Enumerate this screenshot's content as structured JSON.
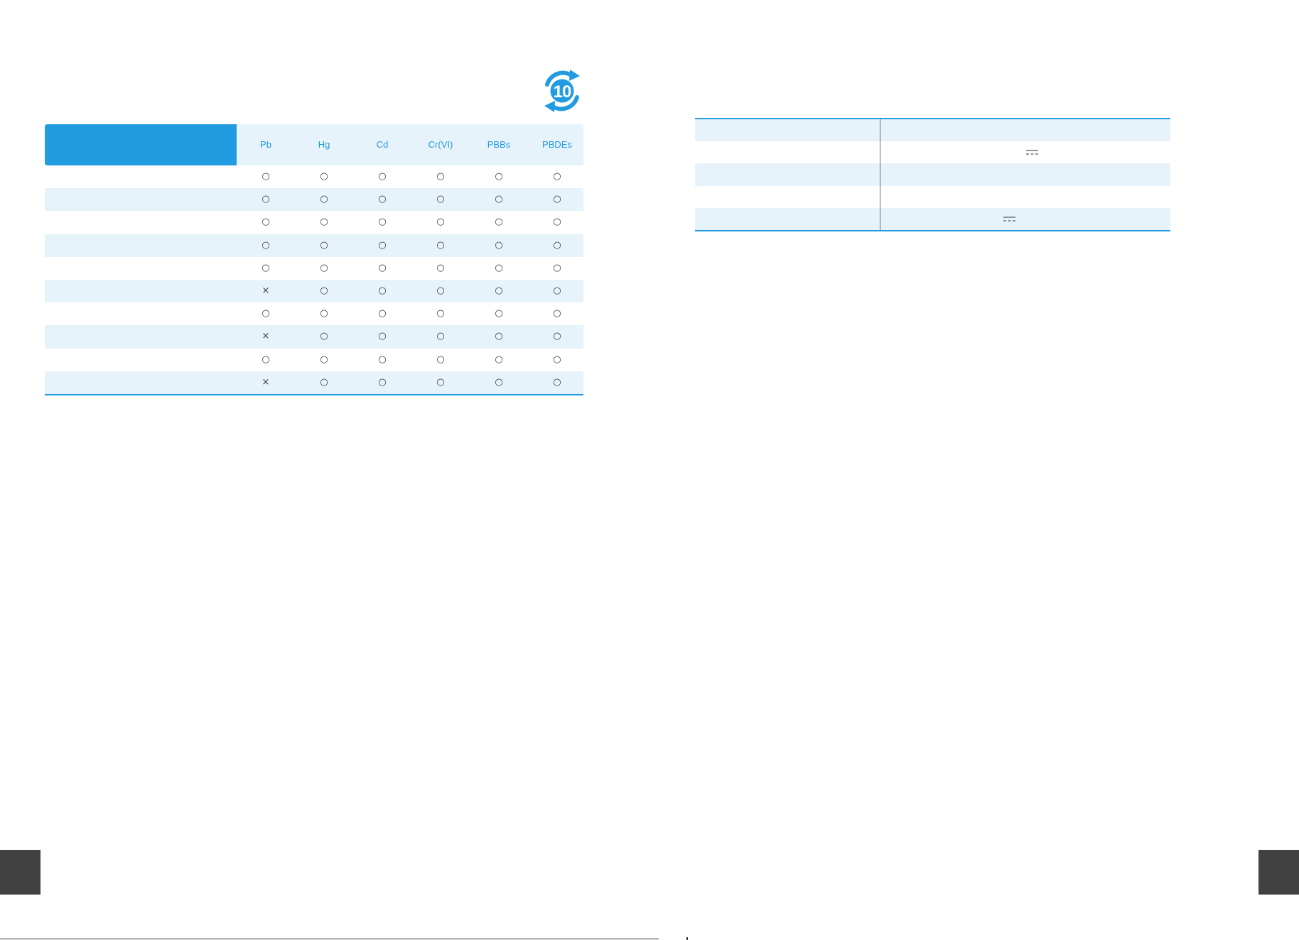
{
  "logo": {
    "label": "10",
    "icon": "efup-recycle-icon",
    "color": "#229be0"
  },
  "hazard_table": {
    "columns": [
      "Pb",
      "Hg",
      "Cd",
      "Cr(VI)",
      "PBBs",
      "PBDEs"
    ],
    "rows": [
      [
        "○",
        "○",
        "○",
        "○",
        "○",
        "○"
      ],
      [
        "○",
        "○",
        "○",
        "○",
        "○",
        "○"
      ],
      [
        "○",
        "○",
        "○",
        "○",
        "○",
        "○"
      ],
      [
        "○",
        "○",
        "○",
        "○",
        "○",
        "○"
      ],
      [
        "○",
        "○",
        "○",
        "○",
        "○",
        "○"
      ],
      [
        "×",
        "○",
        "○",
        "○",
        "○",
        "○"
      ],
      [
        "○",
        "○",
        "○",
        "○",
        "○",
        "○"
      ],
      [
        "×",
        "○",
        "○",
        "○",
        "○",
        "○"
      ],
      [
        "○",
        "○",
        "○",
        "○",
        "○",
        "○"
      ],
      [
        "×",
        "○",
        "○",
        "○",
        "○",
        "○"
      ]
    ]
  },
  "colors": {
    "accent": "#229be0",
    "row_tint": "#e6f3fb",
    "page_tab": "#414141"
  }
}
